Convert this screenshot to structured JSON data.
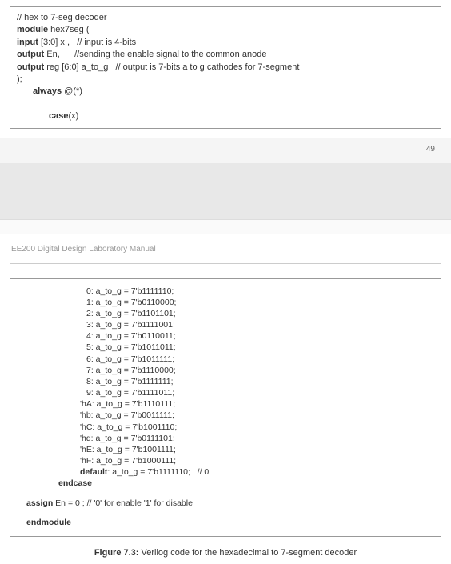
{
  "top": {
    "comment1": "// hex to 7-seg decoder",
    "mod_kw": "module",
    "mod_name": " hex7seg (",
    "input_kw": "input",
    "input_rest": " [3:0] x ,   // input is 4-bits",
    "output1_kw": "output",
    "output1_rest": " En,      //sending the enable signal to the common anode",
    "output2_kw": "output",
    "output2_rest": " reg [6:0] a_to_g   // output is 7-bits a to g cathodes for 7-segment",
    "close_paren": ");",
    "always_kw": "always",
    "always_rest": " @(*)",
    "case_kw": "case",
    "case_rest": "(x)"
  },
  "page_number": "49",
  "manual_title": "EE200 Digital Design Laboratory Manual",
  "cases": {
    "c0": "0: a_to_g = 7'b1111110;",
    "c1": "1: a_to_g = 7'b0110000;",
    "c2": "2: a_to_g = 7'b1101101;",
    "c3": "3: a_to_g = 7'b1111001;",
    "c4": "4: a_to_g = 7'b0110011;",
    "c5": "5: a_to_g = 7'b1011011;",
    "c6": "6: a_to_g = 7'b1011111;",
    "c7": "7: a_to_g = 7'b1110000;",
    "c8": "8: a_to_g = 7'b1111111;",
    "c9": "9: a_to_g = 7'b1111011;",
    "cA": "'hA: a_to_g = 7'b1110111;",
    "cB": "'hb: a_to_g = 7'b0011111;",
    "cC": "'hC: a_to_g = 7'b1001110;",
    "cD": "'hd: a_to_g = 7'b0111101;",
    "cE": "'hE: a_to_g = 7'b1001111;",
    "cF": "'hF: a_to_g = 7'b1000111;",
    "default_kw": "default",
    "default_rest": ": a_to_g = 7'b1111110;   // 0"
  },
  "endcase": "endcase",
  "assign_kw": "assign",
  "assign_rest": " En = 0 ;    // '0' for enable '1' for disable",
  "endmodule": "endmodule",
  "figure": {
    "label": "Figure 7.3:",
    "text": " Verilog code for the hexadecimal to 7-segment decoder"
  }
}
